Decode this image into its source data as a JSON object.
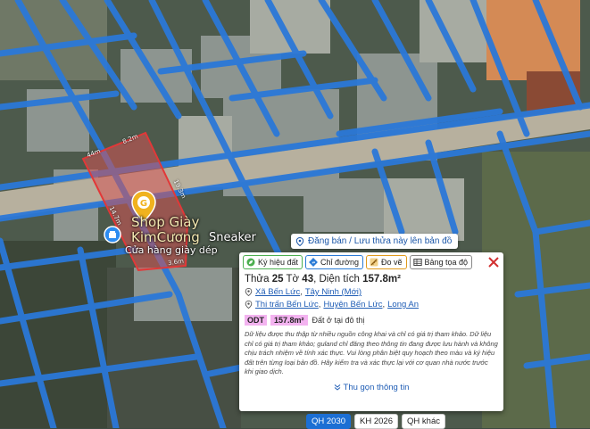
{
  "map": {
    "shop_name_line1": "Shop Giày",
    "shop_name_line2": "KimCương",
    "shop_name_suffix": "Sneaker",
    "shop_subtitle": "Cửa hàng giày dép",
    "shop_icon": "g-marker-icon",
    "edge_labels": [
      "44m",
      "8.2m",
      "19.3m",
      "14.7m",
      "3.6m"
    ]
  },
  "post_banner": {
    "label": "Đăng bán / Lưu thửa này lên bản đồ",
    "icon": "location-pin-icon"
  },
  "popup": {
    "toolbar": [
      {
        "label": "Ký hiệu đất",
        "icon": "leaf-icon",
        "color": "#4caf50"
      },
      {
        "label": "Chỉ đường",
        "icon": "direction-icon",
        "color": "#2b7bd6"
      },
      {
        "label": "Đo vẽ",
        "icon": "ruler-icon",
        "color": "#e09a1b"
      },
      {
        "label": "Bảng tọa độ",
        "icon": "table-icon",
        "color": "#666666"
      }
    ],
    "close_icon": "close-icon",
    "title_prefix": "Thửa",
    "parcel_no": "25",
    "sheet_label": "Tờ",
    "sheet_no": "43",
    "area_label": ", Diện tích",
    "area_value": "157.8m²",
    "address_new": {
      "ward": "Xã Bến Lức",
      "sep": ",",
      "province": "Tây Ninh (Mới)"
    },
    "address_old": {
      "town": "Thị trấn Bến Lức",
      "sep1": ",",
      "district": "Huyện Bến Lức",
      "sep2": ",",
      "province": "Long An"
    },
    "land_code": "ODT",
    "land_area": "157.8m²",
    "land_desc": "Đất ở tại đô thị",
    "disclaimer": "Dữ liệu được thu thập từ nhiều nguồn công khai và chỉ có giá trị tham khảo. Dữ liệu chỉ có giá trị tham khảo; guland chỉ đăng theo thông tin đang được lưu hành và không chịu trách nhiệm về tính xác thực. Vui lòng phân biệt quy hoạch theo màu và ký hiệu đất trên từng loại bản đồ. Hãy kiểm tra và xác thực lại với cơ quan nhà nước trước khi giao dịch.",
    "collapse_label": "Thu gọn thông tin",
    "land_color": "#f3b3f0"
  },
  "layer_tabs": [
    {
      "label": "QH 2030",
      "active": true
    },
    {
      "label": "KH 2026",
      "active": false
    },
    {
      "label": "QH khác",
      "active": false
    }
  ],
  "colors": {
    "accent": "#1c6fd4",
    "parcel_fill": "#d65454",
    "road": "#2b78d8"
  }
}
